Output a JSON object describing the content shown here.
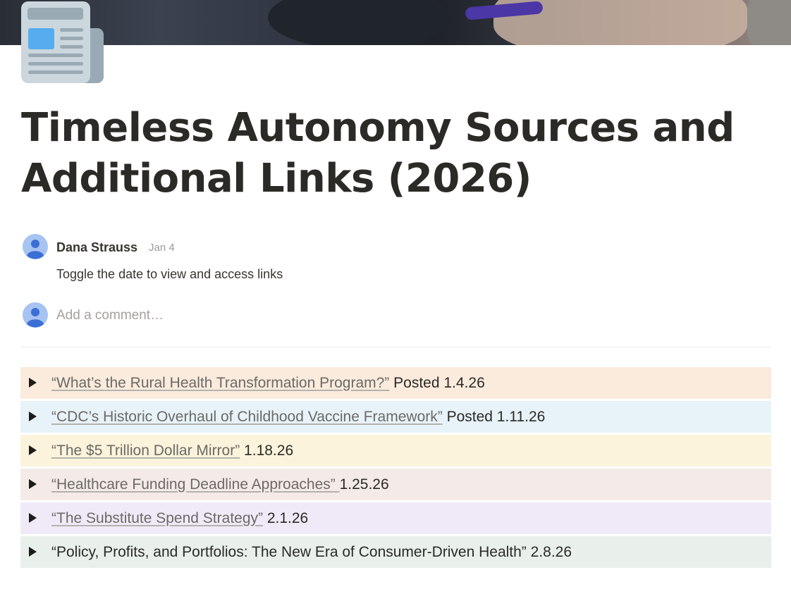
{
  "page": {
    "icon": "newspaper-icon",
    "title": "Timeless Autonomy Sources and Additional Links (2026)"
  },
  "comment": {
    "author": "Dana Strauss",
    "date": "Jan 4",
    "body": "Toggle the date to view and access links",
    "avatar_icon": "user-avatar-icon"
  },
  "add_comment": {
    "placeholder": "Add a comment…",
    "value": ""
  },
  "toggles": [
    {
      "link": "“What’s the Rural Health Transformation Program?”",
      "suffix": " Posted 1.4.26",
      "bg": "#faebdd",
      "linked": true
    },
    {
      "link": " “CDC’s Historic Overhaul of Childhood Vaccine Framework”",
      "suffix": " Posted 1.11.26",
      "bg": "#e7f3f8",
      "linked": true
    },
    {
      "link": " “The $5 Trillion Dollar Mirror”",
      "suffix": " 1.18.26",
      "bg": "#fbf3db",
      "linked": true
    },
    {
      "link": "“Healthcare Funding Deadline Approaches” ",
      "suffix": "1.25.26",
      "bg": "#f4ebe8",
      "linked": true
    },
    {
      "link": "“The Substitute Spend Strategy”",
      "suffix": " 2.1.26",
      "bg": "#f0eaf8",
      "linked": true
    },
    {
      "link": "“Policy, Profits, and Portfolios: The New Era of Consumer-Driven Health” 2.8.26",
      "suffix": "",
      "bg": "#e9f0ec",
      "linked": false
    }
  ],
  "colors": {
    "title": "#2b2a26",
    "link_text": "#6b6a66",
    "muted": "#9b9a97",
    "avatar": "#7ba7ee"
  }
}
